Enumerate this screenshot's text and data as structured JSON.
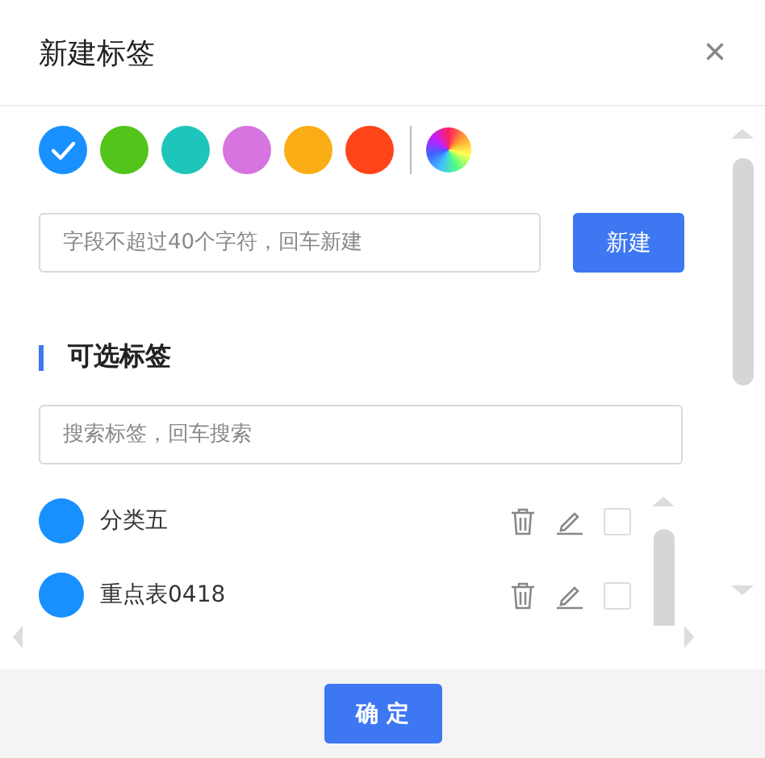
{
  "dialog": {
    "title": "新建标签",
    "close": "×"
  },
  "colors": [
    {
      "color": "#1890ff",
      "selected": true
    },
    {
      "color": "#52c41a",
      "selected": false
    },
    {
      "color": "#1dc5bb",
      "selected": false
    },
    {
      "color": "#d675e0",
      "selected": false
    },
    {
      "color": "#faad14",
      "selected": false
    },
    {
      "color": "#ff4419",
      "selected": false
    }
  ],
  "new_tag": {
    "placeholder": "字段不超过40个字符，回车新建",
    "button": "新建"
  },
  "section_title": "可选标签",
  "search": {
    "placeholder": "搜索标签，回车搜索"
  },
  "tags": [
    {
      "name": "分类五",
      "color": "#1890ff",
      "checked": false
    },
    {
      "name": "重点表0418",
      "color": "#1890ff",
      "checked": false
    }
  ],
  "footer": {
    "button": "确 定"
  }
}
